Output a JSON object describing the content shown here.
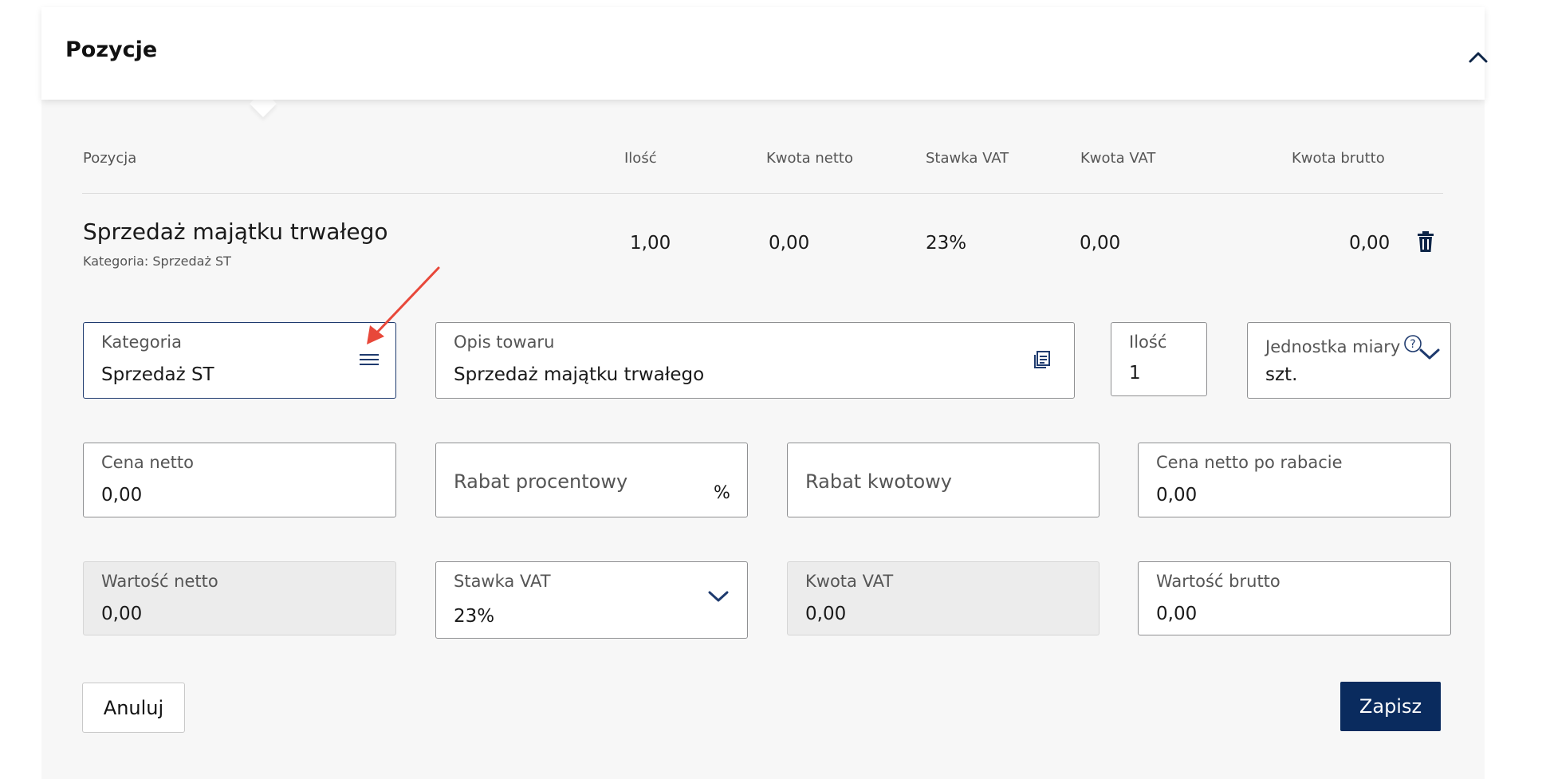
{
  "section": {
    "title": "Pozycje",
    "collapse_icon": "chevron-up-icon"
  },
  "table": {
    "headers": {
      "pozycja": "Pozycja",
      "ilosc": "Ilość",
      "kwota_netto": "Kwota netto",
      "stawka_vat": "Stawka VAT",
      "kwota_vat": "Kwota VAT",
      "kwota_brutto": "Kwota brutto"
    },
    "row": {
      "name": "Sprzedaż majątku trwałego",
      "category": "Kategoria: Sprzedaż ST",
      "ilosc": "1,00",
      "kwota_netto": "0,00",
      "stawka_vat": "23%",
      "kwota_vat": "0,00",
      "kwota_brutto": "0,00",
      "delete_icon": "trash-icon"
    }
  },
  "form": {
    "kategoria": {
      "label": "Kategoria",
      "value": "Sprzedaż ST",
      "icon": "menu-icon"
    },
    "opis_towaru": {
      "label": "Opis towaru",
      "value": "Sprzedaż majątku trwałego",
      "icon": "document-list-icon"
    },
    "ilosc": {
      "label": "Ilość",
      "value": "1"
    },
    "jednostka_miary": {
      "label": "Jednostka miary",
      "value": "szt.",
      "help_icon": "help-icon",
      "icon": "chevron-down-icon"
    },
    "cena_netto": {
      "label": "Cena netto",
      "value": "0,00"
    },
    "rabat_procentowy": {
      "placeholder": "Rabat procentowy",
      "suffix": "%"
    },
    "rabat_kwotowy": {
      "placeholder": "Rabat kwotowy"
    },
    "cena_netto_po_rabacie": {
      "label": "Cena netto po rabacie",
      "value": "0,00"
    },
    "wartosc_netto": {
      "label": "Wartość netto",
      "value": "0,00"
    },
    "stawka_vat": {
      "label": "Stawka VAT",
      "value": "23%",
      "icon": "chevron-down-icon"
    },
    "kwota_vat": {
      "label": "Kwota VAT",
      "value": "0,00"
    },
    "wartosc_brutto": {
      "label": "Wartość brutto",
      "value": "0,00"
    }
  },
  "actions": {
    "cancel_label": "Anuluj",
    "save_label": "Zapisz"
  },
  "colors": {
    "primary": "#0a2b5e",
    "annotation_arrow": "#e8483a",
    "panel_bg": "#f7f7f7"
  }
}
